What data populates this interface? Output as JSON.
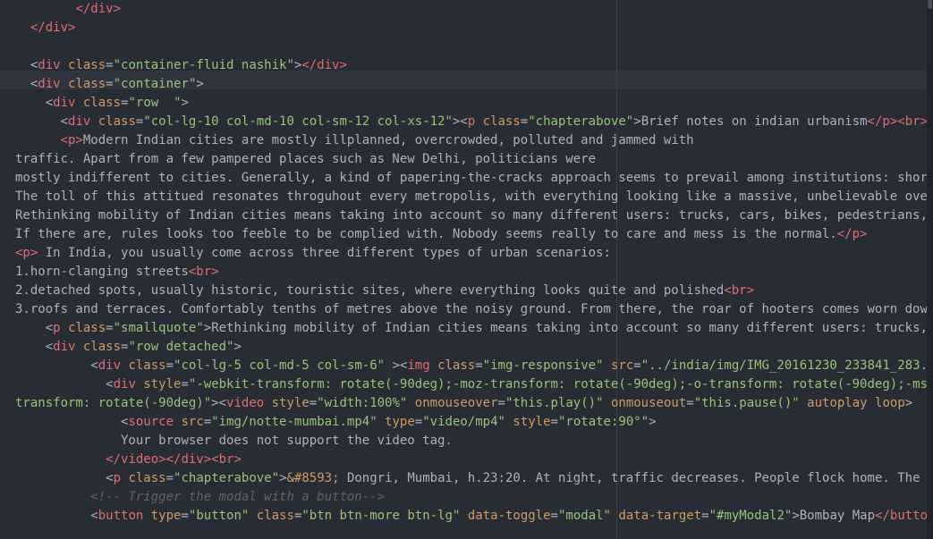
{
  "editor": {
    "language": "html",
    "theme": {
      "background": "#282c34",
      "tag": "#e06c75",
      "attr": "#d19a66",
      "string": "#98c379",
      "text": "#abb2bf",
      "comment": "#5c6370"
    },
    "lines": [
      [
        [
          "text",
          "        "
        ],
        [
          "tag",
          "</div>"
        ]
      ],
      [
        [
          "text",
          "  "
        ],
        [
          "tag",
          "</div>"
        ]
      ],
      [],
      [
        [
          "text",
          "  "
        ],
        [
          "punc",
          "<"
        ],
        [
          "tag",
          "div "
        ],
        [
          "attr",
          "class"
        ],
        [
          "punc",
          "="
        ],
        [
          "str",
          "\"container-fluid nashik\""
        ],
        [
          "punc",
          ">"
        ],
        [
          "tag",
          "</div>"
        ]
      ],
      [
        [
          "text",
          "  "
        ],
        [
          "punc",
          "<"
        ],
        [
          "tag",
          "div "
        ],
        [
          "attr",
          "class"
        ],
        [
          "punc",
          "="
        ],
        [
          "str",
          "\"container\""
        ],
        [
          "punc",
          ">"
        ]
      ],
      [
        [
          "text",
          "    "
        ],
        [
          "punc",
          "<"
        ],
        [
          "tag",
          "div "
        ],
        [
          "attr",
          "class"
        ],
        [
          "punc",
          "="
        ],
        [
          "str",
          "\"row  \""
        ],
        [
          "punc",
          ">"
        ]
      ],
      [
        [
          "text",
          "      "
        ],
        [
          "punc",
          "<"
        ],
        [
          "tag",
          "div "
        ],
        [
          "attr",
          "class"
        ],
        [
          "punc",
          "="
        ],
        [
          "str",
          "\"col-lg-10 col-md-10 col-sm-12 col-xs-12\""
        ],
        [
          "punc",
          ">"
        ],
        [
          "punc",
          "<"
        ],
        [
          "tag",
          "p "
        ],
        [
          "attr",
          "class"
        ],
        [
          "punc",
          "="
        ],
        [
          "str",
          "\"chapterabove\""
        ],
        [
          "punc",
          ">"
        ],
        [
          "text",
          "Brief notes on indian urbanism"
        ],
        [
          "tag",
          "</p>"
        ],
        [
          "tag",
          "<br>"
        ]
      ],
      [
        [
          "text",
          "      "
        ],
        [
          "tag",
          "<p>"
        ],
        [
          "text",
          "Modern Indian cities are mostly illplanned, overcrowded, polluted and jammed with"
        ]
      ],
      [
        [
          "text",
          "traffic. Apart from a few pampered places such as New Delhi, politicians were"
        ]
      ],
      [
        [
          "text",
          "mostly indifferent to cities. Generally, a kind of papering-the-cracks approach seems to prevail among institutions: shor"
        ]
      ],
      [
        [
          "text",
          "The toll of this attitued resonates throguhout every metropolis, with everything looking like a massive, unbelievable ove"
        ]
      ],
      [
        [
          "text",
          "Rethinking mobility of Indian cities means taking into account so many different users: trucks, cars, bikes, pedestrians,"
        ]
      ],
      [
        [
          "text",
          "If there are, rules looks too feeble to be complied with. Nobody seems really to care and mess is the normal."
        ],
        [
          "tag",
          "</p>"
        ]
      ],
      [
        [
          "tag",
          "<p>"
        ],
        [
          "text",
          " In India, you usually come across three different types of urban scenarios:"
        ]
      ],
      [
        [
          "text",
          "1.horn-clanging streets"
        ],
        [
          "tag",
          "<br>"
        ]
      ],
      [
        [
          "text",
          "2.detached spots, usually historic, touristic sites, where everything looks quite and polished"
        ],
        [
          "tag",
          "<br>"
        ]
      ],
      [
        [
          "text",
          "3.roofs and terraces. Comfortably tenths of metres above the noisy ground. From there, the roar of hooters comes worn dow"
        ]
      ],
      [
        [
          "text",
          "    "
        ],
        [
          "punc",
          "<"
        ],
        [
          "tag",
          "p "
        ],
        [
          "attr",
          "class"
        ],
        [
          "punc",
          "="
        ],
        [
          "str",
          "\"smallquote\""
        ],
        [
          "punc",
          ">"
        ],
        [
          "text",
          "Rethinking mobility of Indian cities means taking into account so many different users: trucks,"
        ]
      ],
      [
        [
          "text",
          "    "
        ],
        [
          "punc",
          "<"
        ],
        [
          "tag",
          "div "
        ],
        [
          "attr",
          "class"
        ],
        [
          "punc",
          "="
        ],
        [
          "str",
          "\"row detached\""
        ],
        [
          "punc",
          ">"
        ]
      ],
      [
        [
          "text",
          "          "
        ],
        [
          "punc",
          "<"
        ],
        [
          "tag",
          "div "
        ],
        [
          "attr",
          "class"
        ],
        [
          "punc",
          "="
        ],
        [
          "str",
          "\"col-lg-5 col-md-5 col-sm-6\""
        ],
        [
          "punc",
          " >"
        ],
        [
          "punc",
          "<"
        ],
        [
          "tag",
          "img "
        ],
        [
          "attr",
          "class"
        ],
        [
          "punc",
          "="
        ],
        [
          "str",
          "\"img-responsive\""
        ],
        [
          "text",
          " "
        ],
        [
          "attr",
          "src"
        ],
        [
          "punc",
          "="
        ],
        [
          "str",
          "\"../india/img/IMG_20161230_233841_283.j"
        ]
      ],
      [
        [
          "text",
          "            "
        ],
        [
          "punc",
          "<"
        ],
        [
          "tag",
          "div "
        ],
        [
          "attr",
          "style"
        ],
        [
          "punc",
          "="
        ],
        [
          "str",
          "\"-webkit-transform: rotate(-90deg);-moz-transform: rotate(-90deg);-o-transform: rotate(-90deg);-ms-"
        ]
      ],
      [
        [
          "str",
          "transform: rotate(-90deg)\""
        ],
        [
          "punc",
          ">"
        ],
        [
          "punc",
          "<"
        ],
        [
          "tag",
          "video "
        ],
        [
          "attr",
          "style"
        ],
        [
          "punc",
          "="
        ],
        [
          "str",
          "\"width:100%\""
        ],
        [
          "text",
          " "
        ],
        [
          "attr",
          "onmouseover"
        ],
        [
          "punc",
          "="
        ],
        [
          "str",
          "\"this.play()\""
        ],
        [
          "text",
          " "
        ],
        [
          "attr",
          "onmouseout"
        ],
        [
          "punc",
          "="
        ],
        [
          "str",
          "\"this.pause()\""
        ],
        [
          "text",
          " "
        ],
        [
          "attr",
          "autoplay"
        ],
        [
          "text",
          " "
        ],
        [
          "attr",
          "loop"
        ],
        [
          "punc",
          ">"
        ]
      ],
      [
        [
          "text",
          "              "
        ],
        [
          "punc",
          "<"
        ],
        [
          "tag",
          "source "
        ],
        [
          "attr",
          "src"
        ],
        [
          "punc",
          "="
        ],
        [
          "str",
          "\"img/notte-mumbai.mp4\""
        ],
        [
          "text",
          " "
        ],
        [
          "attr",
          "type"
        ],
        [
          "punc",
          "="
        ],
        [
          "str",
          "\"video/mp4\""
        ],
        [
          "text",
          " "
        ],
        [
          "attr",
          "style"
        ],
        [
          "punc",
          "="
        ],
        [
          "str",
          "\"rotate:90°\""
        ],
        [
          "punc",
          ">"
        ]
      ],
      [
        [
          "text",
          "              Your browser does not support the video tag."
        ]
      ],
      [
        [
          "text",
          "            "
        ],
        [
          "tag",
          "</video>"
        ],
        [
          "tag",
          "</div>"
        ],
        [
          "tag",
          "<br>"
        ]
      ],
      [
        [
          "text",
          "            "
        ],
        [
          "punc",
          "<"
        ],
        [
          "tag",
          "p "
        ],
        [
          "attr",
          "class"
        ],
        [
          "punc",
          "="
        ],
        [
          "str",
          "\"chapterabove\""
        ],
        [
          "punc",
          ">"
        ],
        [
          "ent",
          "&#8593;"
        ],
        [
          "text",
          " Dongri, Mumbai, h.23:20. At night, traffic decreases. People flock home. The b"
        ]
      ],
      [
        [
          "text",
          "          "
        ],
        [
          "comment",
          "<!-- Trigger the modal with a button-->"
        ]
      ],
      [
        [
          "text",
          "          "
        ],
        [
          "punc",
          "<"
        ],
        [
          "tag",
          "button "
        ],
        [
          "attr",
          "type"
        ],
        [
          "punc",
          "="
        ],
        [
          "str",
          "\"button\""
        ],
        [
          "text",
          " "
        ],
        [
          "attr",
          "class"
        ],
        [
          "punc",
          "="
        ],
        [
          "str",
          "\"btn btn-more btn-lg\""
        ],
        [
          "text",
          " "
        ],
        [
          "attr",
          "data-toggle"
        ],
        [
          "punc",
          "="
        ],
        [
          "str",
          "\"modal\""
        ],
        [
          "text",
          " "
        ],
        [
          "attr",
          "data-target"
        ],
        [
          "punc",
          "="
        ],
        [
          "str",
          "\"#myModal2\""
        ],
        [
          "punc",
          ">"
        ],
        [
          "text",
          "Bombay Map"
        ],
        [
          "tag",
          "</butto"
        ]
      ]
    ]
  }
}
